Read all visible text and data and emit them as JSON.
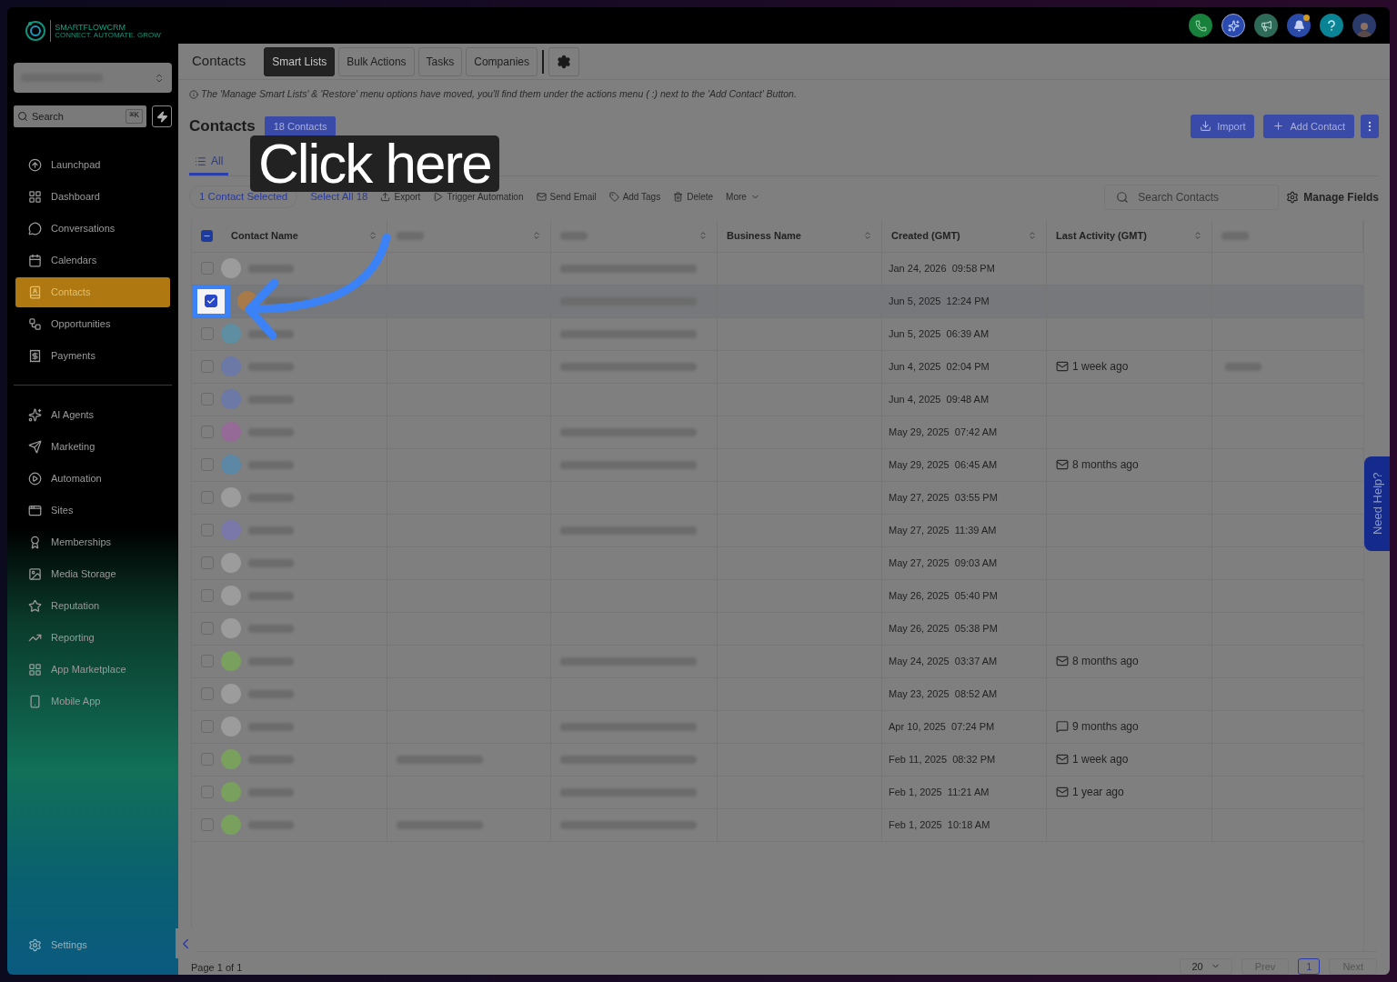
{
  "brand": {
    "name": "SMARTFLOWCRM",
    "tagline": "CONNECT. AUTOMATE. GROW"
  },
  "sidebar": {
    "search": {
      "placeholder": "Search",
      "shortcut": "⌘K"
    },
    "groups": [
      [
        {
          "label": "Launchpad",
          "selected": false
        },
        {
          "label": "Dashboard",
          "selected": false
        },
        {
          "label": "Conversations",
          "selected": false
        },
        {
          "label": "Calendars",
          "selected": false
        },
        {
          "label": "Contacts",
          "selected": true
        },
        {
          "label": "Opportunities",
          "selected": false
        },
        {
          "label": "Payments",
          "selected": false
        }
      ],
      [
        {
          "label": "AI Agents",
          "selected": false
        },
        {
          "label": "Marketing",
          "selected": false
        },
        {
          "label": "Automation",
          "selected": false
        },
        {
          "label": "Sites",
          "selected": false
        },
        {
          "label": "Memberships",
          "selected": false
        },
        {
          "label": "Media Storage",
          "selected": false
        },
        {
          "label": "Reputation",
          "selected": false
        },
        {
          "label": "Reporting",
          "selected": false
        },
        {
          "label": "App Marketplace",
          "selected": false
        },
        {
          "label": "Mobile App",
          "selected": false
        }
      ]
    ],
    "settings": "Settings"
  },
  "topbar": {
    "notification_dot": true
  },
  "header": {
    "title": "Contacts",
    "tabs": [
      {
        "label": "Smart Lists",
        "selected": true
      },
      {
        "label": "Bulk Actions",
        "selected": false
      },
      {
        "label": "Tasks",
        "selected": false
      },
      {
        "label": "Companies",
        "selected": false
      }
    ]
  },
  "notice": "The 'Manage Smart Lists' & 'Restore' menu options have moved, you'll find them under the actions menu ( :) next to the 'Add Contact' Button.",
  "page": {
    "title": "Contacts",
    "count": "18 Contacts",
    "buttons": [
      "Import",
      "Add Contact"
    ]
  },
  "list_tabs": [
    {
      "label": "All",
      "selected": true
    }
  ],
  "toolbar": {
    "selection": "1 Contact Selected",
    "select_all": "Select All 18",
    "actions": [
      "Export",
      "Trigger Automation",
      "Send Email",
      "Add Tags",
      "Delete",
      "More"
    ],
    "search_placeholder": "Search Contacts",
    "manage": "Manage Fields"
  },
  "table": {
    "header_indeterminate": true,
    "columns": [
      {
        "kind": "text",
        "label": "Contact Name",
        "sortable": true
      },
      {
        "kind": "redacted",
        "sortable": true
      },
      {
        "kind": "redacted",
        "sortable": true
      },
      {
        "kind": "text",
        "label": "Business Name",
        "sortable": true
      },
      {
        "kind": "text",
        "label": "Created (GMT)",
        "sortable": true
      },
      {
        "kind": "text",
        "label": "Last Activity (GMT)",
        "sortable": true
      },
      {
        "kind": "redacted",
        "sortable": false
      }
    ],
    "rows": [
      {
        "selected": false,
        "spotlight": false,
        "color": "#9c9c9c",
        "has_phone": false,
        "has_email": true,
        "created": "Jan 24, 2026  09:58 PM",
        "has_tag": false
      },
      {
        "selected": true,
        "spotlight": true,
        "color": "#a87a48",
        "has_phone": false,
        "has_email": true,
        "created": "Jun 5, 2025  12:24 PM",
        "has_tag": false
      },
      {
        "selected": false,
        "spotlight": false,
        "color": "#5e8ea2",
        "has_phone": false,
        "has_email": true,
        "created": "Jun 5, 2025  06:39 AM",
        "has_tag": false
      },
      {
        "selected": false,
        "spotlight": false,
        "color": "#6c78a6",
        "has_phone": false,
        "has_email": true,
        "created": "Jun 4, 2025  02:04 PM",
        "activity": {
          "kind": "mail",
          "text": "1 week ago"
        },
        "has_tag": true
      },
      {
        "selected": false,
        "spotlight": false,
        "color": "#6c78a6",
        "has_phone": false,
        "has_email": false,
        "created": "Jun 4, 2025  09:48 AM",
        "has_tag": false
      },
      {
        "selected": false,
        "spotlight": false,
        "color": "#966a96",
        "has_phone": false,
        "has_email": true,
        "created": "May 29, 2025  07:42 AM",
        "has_tag": false
      },
      {
        "selected": false,
        "spotlight": false,
        "color": "#5c88a6",
        "has_phone": false,
        "has_email": true,
        "created": "May 29, 2025  06:45 AM",
        "activity": {
          "kind": "mail",
          "text": "8 months ago"
        },
        "has_tag": false
      },
      {
        "selected": false,
        "spotlight": false,
        "color": "#9c9c9c",
        "has_phone": false,
        "has_email": false,
        "created": "May 27, 2025  03:55 PM",
        "has_tag": false
      },
      {
        "selected": false,
        "spotlight": false,
        "color": "#7a78a8",
        "has_phone": false,
        "has_email": true,
        "created": "May 27, 2025  11:39 AM",
        "has_tag": false
      },
      {
        "selected": false,
        "spotlight": false,
        "color": "#9c9c9c",
        "has_phone": false,
        "has_email": false,
        "created": "May 27, 2025  09:03 AM",
        "has_tag": false
      },
      {
        "selected": false,
        "spotlight": false,
        "color": "#9c9c9c",
        "has_phone": false,
        "has_email": false,
        "created": "May 26, 2025  05:40 PM",
        "has_tag": false
      },
      {
        "selected": false,
        "spotlight": false,
        "color": "#9c9c9c",
        "has_phone": false,
        "has_email": false,
        "created": "May 26, 2025  05:38 PM",
        "has_tag": false
      },
      {
        "selected": false,
        "spotlight": false,
        "color": "#7aa05e",
        "has_phone": false,
        "has_email": true,
        "created": "May 24, 2025  03:37 AM",
        "activity": {
          "kind": "mail",
          "text": "8 months ago"
        },
        "has_tag": false
      },
      {
        "selected": false,
        "spotlight": false,
        "color": "#9c9c9c",
        "has_phone": false,
        "has_email": false,
        "created": "May 23, 2025  08:52 AM",
        "has_tag": false
      },
      {
        "selected": false,
        "spotlight": false,
        "color": "#9c9c9c",
        "has_phone": false,
        "has_email": true,
        "created": "Apr 10, 2025  07:24 PM",
        "activity": {
          "kind": "chat",
          "text": "9 months ago"
        },
        "has_tag": false
      },
      {
        "selected": false,
        "spotlight": false,
        "color": "#7aa05e",
        "has_phone": true,
        "has_email": true,
        "created": "Feb 11, 2025  08:32 PM",
        "activity": {
          "kind": "mail",
          "text": "1 week ago"
        },
        "has_tag": false
      },
      {
        "selected": false,
        "spotlight": false,
        "color": "#7aa05e",
        "has_phone": false,
        "has_email": true,
        "created": "Feb 1, 2025  11:21 AM",
        "activity": {
          "kind": "mail",
          "text": "1 year ago"
        },
        "has_tag": false
      },
      {
        "selected": false,
        "spotlight": false,
        "color": "#7aa05e",
        "has_phone": true,
        "has_email": true,
        "created": "Feb 1, 2025  10:18 AM",
        "has_tag": false
      }
    ]
  },
  "pagination": {
    "summary": "Page 1 of 1",
    "per_page": "20",
    "prev": "Prev",
    "pages": [
      {
        "label": "1",
        "selected": true
      }
    ],
    "next": "Next"
  },
  "callout": "Click here",
  "help_tab": "Need Help?"
}
